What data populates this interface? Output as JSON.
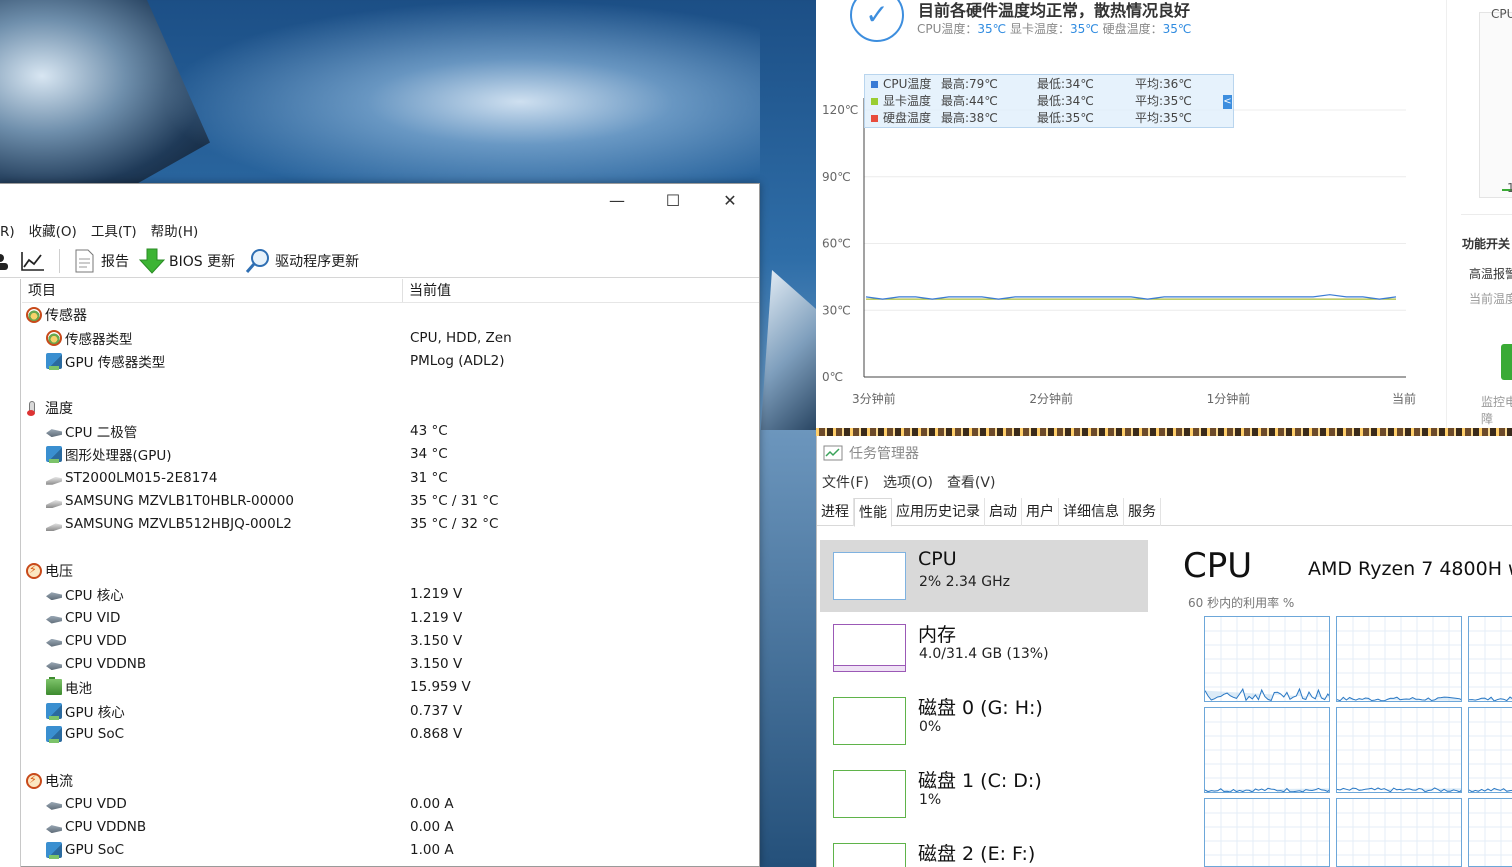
{
  "colors": {
    "accent": "#3d8ede",
    "cpu_series": "#3a7bd5",
    "gpu_series": "#9acd32",
    "hdd_series": "#e84c3d",
    "mem_border": "#9b59b6",
    "disk_border": "#5fb34a"
  },
  "aida": {
    "window_controls": {
      "minimize": "—",
      "maximize": "☐",
      "close": "✕"
    },
    "menu": [
      "R)",
      "收藏(O)",
      "工具(T)",
      "帮助(H)"
    ],
    "toolbar": {
      "report": "报告",
      "bios": "BIOS 更新",
      "driver": "驱动程序更新"
    },
    "columns": {
      "item": "项目",
      "value": "当前值"
    },
    "rows": [
      {
        "kind": "group",
        "icon": "sensor-icon",
        "label": "传感器",
        "value": ""
      },
      {
        "kind": "item",
        "icon": "sensor-icon",
        "label": "传感器类型",
        "value": "CPU, HDD, Zen"
      },
      {
        "kind": "item",
        "icon": "gpu-icon",
        "label": "GPU 传感器类型",
        "value": "PMLog  (ADL2)"
      },
      {
        "kind": "spacer"
      },
      {
        "kind": "group",
        "icon": "thermometer-icon",
        "label": "温度",
        "value": ""
      },
      {
        "kind": "item",
        "icon": "chip-icon",
        "label": "CPU 二极管",
        "value": "43 °C"
      },
      {
        "kind": "item",
        "icon": "gpu-icon",
        "label": "图形处理器(GPU)",
        "value": "34 °C"
      },
      {
        "kind": "item",
        "icon": "hdd-icon",
        "label": "ST2000LM015-2E8174",
        "value": "31 °C"
      },
      {
        "kind": "item",
        "icon": "hdd-icon",
        "label": "SAMSUNG MZVLB1T0HBLR-00000",
        "value": "35 °C / 31 °C"
      },
      {
        "kind": "item",
        "icon": "hdd-icon",
        "label": "SAMSUNG MZVLB512HBJQ-000L2",
        "value": "35 °C / 32 °C"
      },
      {
        "kind": "spacer"
      },
      {
        "kind": "group",
        "icon": "voltage-icon",
        "label": "电压",
        "value": ""
      },
      {
        "kind": "item",
        "icon": "chip-icon",
        "label": "CPU 核心",
        "value": "1.219 V"
      },
      {
        "kind": "item",
        "icon": "chip-icon",
        "label": "CPU VID",
        "value": "1.219 V"
      },
      {
        "kind": "item",
        "icon": "chip-icon",
        "label": "CPU VDD",
        "value": "3.150 V"
      },
      {
        "kind": "item",
        "icon": "chip-icon",
        "label": "CPU VDDNB",
        "value": "3.150 V"
      },
      {
        "kind": "item",
        "icon": "battery-icon",
        "label": "电池",
        "value": "15.959 V"
      },
      {
        "kind": "item",
        "icon": "gpu-icon",
        "label": "GPU 核心",
        "value": "0.737 V"
      },
      {
        "kind": "item",
        "icon": "gpu-icon",
        "label": "GPU SoC",
        "value": "0.868 V"
      },
      {
        "kind": "spacer"
      },
      {
        "kind": "group",
        "icon": "current-icon",
        "label": "电流",
        "value": ""
      },
      {
        "kind": "item",
        "icon": "chip-icon",
        "label": "CPU VDD",
        "value": "0.00 A"
      },
      {
        "kind": "item",
        "icon": "chip-icon",
        "label": "CPU VDDNB",
        "value": "0.00 A"
      },
      {
        "kind": "item",
        "icon": "gpu-icon",
        "label": "GPU SoC",
        "value": "1.00 A"
      }
    ]
  },
  "tempmon": {
    "headline": "目前各硬件温度均正常，散热情况良好",
    "sub": {
      "cpu_label": "CPU温度：",
      "cpu_val": "35℃",
      "gpu_label": "显卡温度：",
      "gpu_val": "35℃",
      "hdd_label": "硬盘温度：",
      "hdd_val": "35℃"
    },
    "legend": [
      {
        "name": "CPU温度",
        "max": "最高:79℃",
        "min": "最低:34℃",
        "avg": "平均:36℃"
      },
      {
        "name": "显卡温度",
        "max": "最高:44℃",
        "min": "最低:34℃",
        "avg": "平均:35℃"
      },
      {
        "name": "硬盘温度",
        "max": "最高:38℃",
        "min": "最低:35℃",
        "avg": "平均:35℃"
      }
    ],
    "collapse_glyph": "<",
    "side": {
      "top_label": "CPU",
      "scale_label": "1",
      "section": "功能开关",
      "alarm": "高温报警",
      "current": "当前温度达",
      "footer1": "监控电",
      "footer2": "障"
    }
  },
  "chart_data": {
    "type": "line",
    "title": "",
    "y_ticks": [
      "0℃",
      "30℃",
      "60℃",
      "90℃",
      "120℃"
    ],
    "x_ticks": [
      "3分钟前",
      "2分钟前",
      "1分钟前",
      "当前"
    ],
    "ylim": [
      0,
      120
    ],
    "grid": true,
    "legend_position": "top-left",
    "series": [
      {
        "name": "CPU温度",
        "values": [
          36,
          35,
          36,
          36,
          35,
          36,
          36,
          36,
          35,
          36,
          36,
          36,
          36,
          36,
          36,
          36,
          36,
          35,
          36,
          36,
          36,
          36,
          36,
          36,
          36,
          36,
          36,
          36,
          37,
          36,
          36,
          35,
          36
        ]
      },
      {
        "name": "显卡温度",
        "values": [
          35,
          35,
          35,
          35,
          35,
          35,
          35,
          35,
          35,
          35,
          35,
          35,
          35,
          35,
          35,
          35,
          35,
          35,
          35,
          35,
          35,
          35,
          35,
          35,
          35,
          35,
          35,
          35,
          35,
          35,
          35,
          35,
          35
        ]
      },
      {
        "name": "硬盘温度",
        "values": [
          35,
          35,
          35,
          35,
          35,
          35,
          35,
          35,
          35,
          35,
          35,
          35,
          35,
          35,
          35,
          35,
          35,
          35,
          35,
          35,
          35,
          35,
          35,
          35,
          35,
          35,
          35,
          35,
          35,
          35,
          35,
          35,
          35
        ]
      }
    ]
  },
  "taskmgr": {
    "title": "任务管理器",
    "menu": [
      "文件(F)",
      "选项(O)",
      "查看(V)"
    ],
    "tabs": [
      "进程",
      "性能",
      "应用历史记录",
      "启动",
      "用户",
      "详细信息",
      "服务"
    ],
    "active_tab": 1,
    "tiles": [
      {
        "name": "CPU",
        "value": "2% 2.34 GHz"
      },
      {
        "name": "内存",
        "value": "4.0/31.4 GB (13%)"
      },
      {
        "name": "磁盘 0 (G: H:)",
        "value": "0%"
      },
      {
        "name": "磁盘 1 (C: D:)",
        "value": "1%"
      },
      {
        "name": "磁盘 2 (E: F:)",
        "value": ""
      }
    ],
    "detail": {
      "heading": "CPU",
      "cpu_name": "AMD Ryzen 7 4800H w",
      "util_label": "60 秒内的利用率 %"
    }
  }
}
